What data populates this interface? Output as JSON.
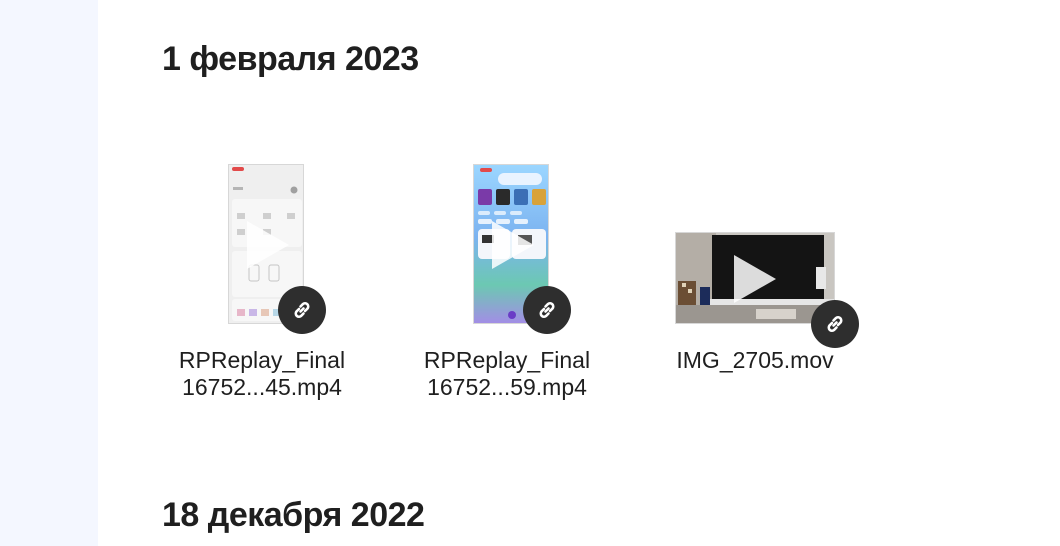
{
  "groups": [
    {
      "date": "1 февраля 2023",
      "files": [
        {
          "name_line1": "RPReplay_Final",
          "name_line2": "16752...45.mp4"
        },
        {
          "name_line1": "RPReplay_Final",
          "name_line2": "16752...59.mp4"
        },
        {
          "name_line1": "IMG_2705.mov",
          "name_line2": ""
        }
      ]
    },
    {
      "date": "18 декабря 2022",
      "files": []
    }
  ],
  "icons": {
    "play": "play-icon",
    "link": "link-icon"
  },
  "colors": {
    "sidebar_bg": "#f4f7ff",
    "link_badge_bg": "#2e2e2e",
    "text": "#1f1f1f"
  }
}
